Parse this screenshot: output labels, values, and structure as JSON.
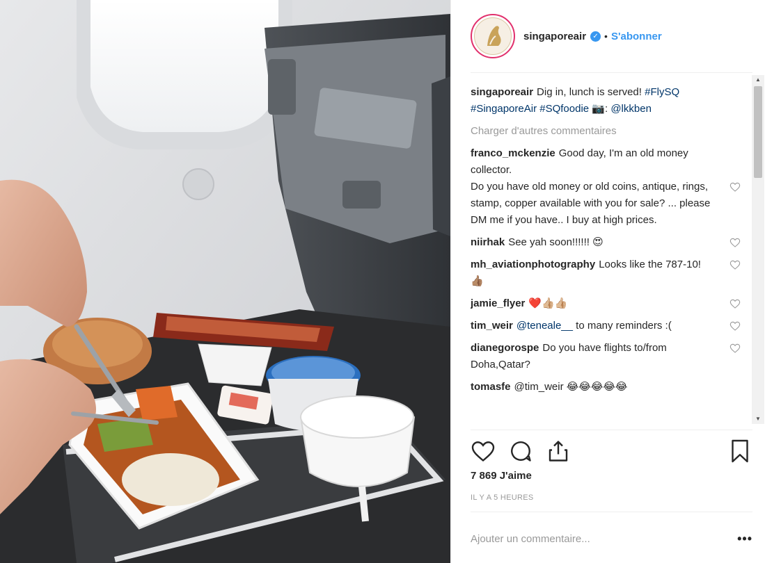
{
  "post": {
    "username": "singaporeair",
    "verified_icon": "verified-badge-icon",
    "separator": "•",
    "follow_label": "S'abonner"
  },
  "caption": {
    "user": "singaporeair",
    "text": "Dig in, lunch is served!",
    "tags": [
      "#FlySQ",
      "#SingaporeAir",
      "#SQfoodie"
    ],
    "camera_emoji": "📷",
    "credit_sep": ":",
    "credit": "@lkkben"
  },
  "load_more": "Charger d'autres commentaires",
  "comments": [
    {
      "user": "franco_mckenzie",
      "text": "Good day, I'm an old money collector.\nDo you have old money or old coins, antique, rings, stamp, copper available with you for sale? ... please DM me if you have.. I buy at high prices."
    },
    {
      "user": "niirhak",
      "text": "See yah soon!!!!!! 😍"
    },
    {
      "user": "mh_aviationphotography",
      "text": "Looks like the 787-10! 👍🏽"
    },
    {
      "user": "jamie_flyer",
      "text": "❤️👍🏼👍🏼"
    },
    {
      "user": "tim_weir",
      "mention": "@teneale__",
      "text": "to many reminders :("
    },
    {
      "user": "dianegorospe",
      "text": "Do you have flights to/from Doha,Qatar?"
    },
    {
      "user": "tomasfe",
      "text": "@tim_weir 😂😂😂😂😂"
    }
  ],
  "actions": {
    "like_icon": "heart-icon",
    "comment_icon": "comment-bubble-icon",
    "share_icon": "share-icon",
    "save_icon": "bookmark-icon"
  },
  "likes": "7 869 J'aime",
  "time": "IL Y A 5 HEURES",
  "add_comment": {
    "placeholder": "Ajouter un commentaire...",
    "more_label": "•••"
  },
  "colors": {
    "link": "#003569",
    "follow": "#3897f0",
    "muted": "#999999",
    "text": "#262626"
  }
}
